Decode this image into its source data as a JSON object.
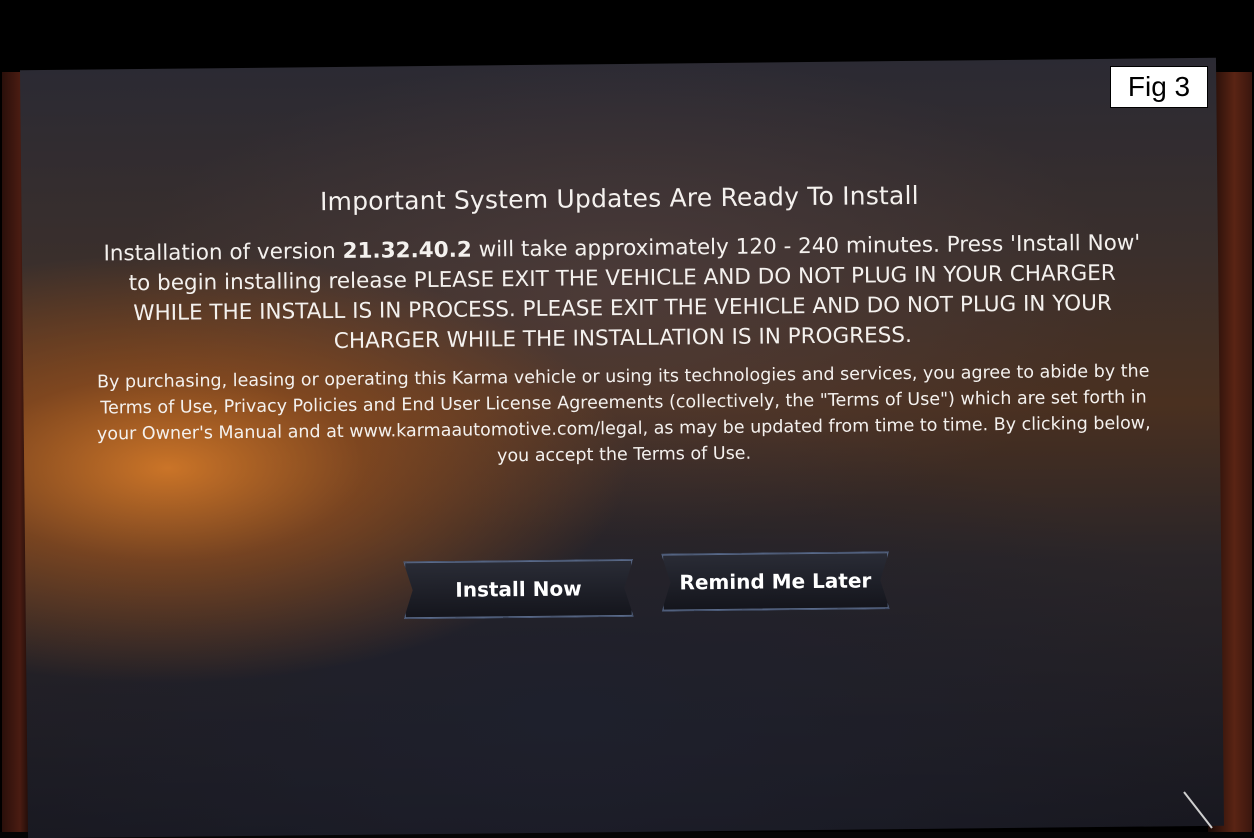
{
  "figure_label": "Fig 3",
  "dialog": {
    "title": "Important System Updates Are Ready To Install",
    "body_prefix": "Installation of version ",
    "version": "21.32.40.2",
    "body_mid": "  will take approximately ",
    "duration": "120 - 240",
    "body_suffix": " minutes. Press 'Install Now' to begin installing release PLEASE EXIT THE VEHICLE AND DO NOT PLUG IN YOUR CHARGER WHILE THE INSTALL IS IN PROCESS. PLEASE EXIT THE VEHICLE AND DO NOT PLUG IN YOUR CHARGER WHILE THE INSTALLATION IS IN PROGRESS.",
    "legal": "By purchasing, leasing or operating this Karma vehicle or using its technologies and services, you agree to abide by the Terms of Use, Privacy Policies and End User License Agreements (collectively, the \"Terms of Use\") which are set forth in your Owner's Manual and at www.karmaautomotive.com/legal, as may be updated from time to time.  By clicking below, you accept the Terms of Use."
  },
  "buttons": {
    "install_label": "Install Now",
    "remind_label": "Remind Me Later"
  },
  "colors": {
    "text": "#f4f1ee",
    "button_bg": "#14151c",
    "button_border": "#4c5c7a",
    "glow": "#d27828"
  }
}
